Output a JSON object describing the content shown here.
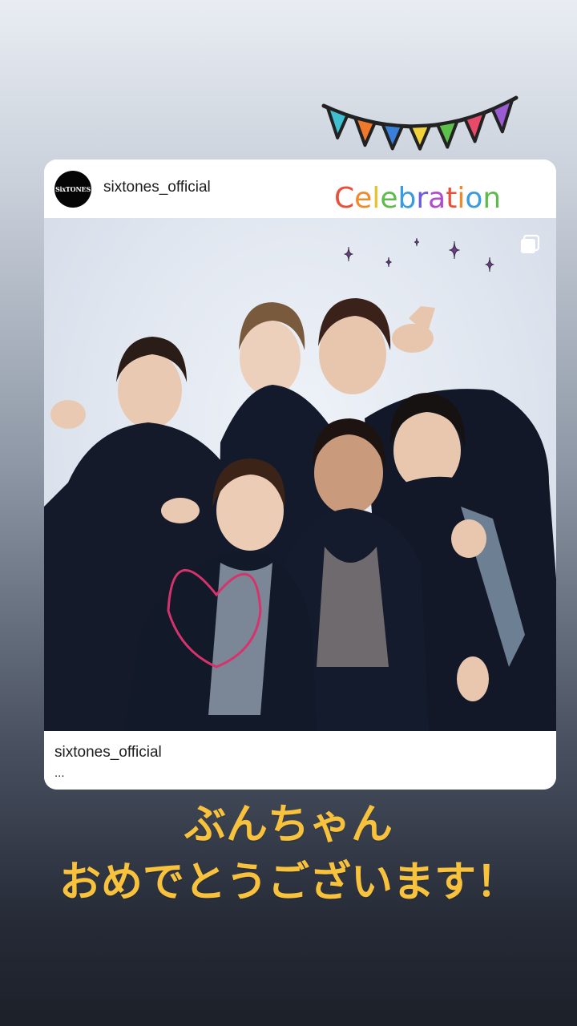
{
  "post": {
    "avatar_text": "SixTONES",
    "username": "sixtones_official",
    "caption_username": "sixtones_official",
    "caption_more": "..."
  },
  "stickers": {
    "celebration_text": "Celebration",
    "bunting_colors": [
      "#3fbfd0",
      "#f07a2a",
      "#3a7fd8",
      "#f2d23a",
      "#5cc04a",
      "#e84a6a",
      "#9a5cd0"
    ],
    "sparkle_color": "#6b3f86",
    "heart_color": "#d6336c"
  },
  "message": {
    "line1": "ぶんちゃん",
    "line2": "おめでとうございます！"
  },
  "colors": {
    "message": "#f9c23c"
  }
}
